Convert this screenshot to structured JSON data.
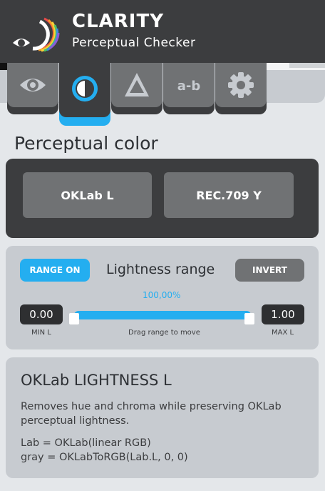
{
  "app": {
    "title": "CLARITY",
    "subtitle": "Perceptual Checker"
  },
  "tabs": [
    {
      "name": "vision",
      "icon": "eye-icon",
      "active": false
    },
    {
      "name": "contrast",
      "icon": "half-circle-icon",
      "active": true
    },
    {
      "name": "delta",
      "icon": "triangle-icon",
      "active": false
    },
    {
      "name": "difference",
      "icon": "a-minus-b-icon",
      "label": "a-b",
      "active": false
    },
    {
      "name": "settings",
      "icon": "gear-icon",
      "active": false
    }
  ],
  "section_title": "Perceptual color",
  "metrics": {
    "oklab_label": "OKLab L",
    "rec709_label": "REC.709 Y"
  },
  "lightness": {
    "range_on_label": "RANGE ON",
    "title": "Lightness range",
    "invert_label": "INVERT",
    "percent": "100,00%",
    "min_value": "0.00",
    "max_value": "1.00",
    "min_label": "MIN L",
    "max_label": "MAX L",
    "hint": "Drag range to move"
  },
  "info": {
    "title": "OKLab LIGHTNESS L",
    "description": "Removes hue and chroma while preserving OKLab perceptual lightness.",
    "code_line1": "Lab = OKLab(linear RGB)",
    "code_line2": "gray = OKLabToRGB(Lab.L, 0, 0)"
  },
  "colors": {
    "accent": "#24aef0",
    "header_bg": "#3c3d3f",
    "page_bg": "#e4e7ea"
  }
}
